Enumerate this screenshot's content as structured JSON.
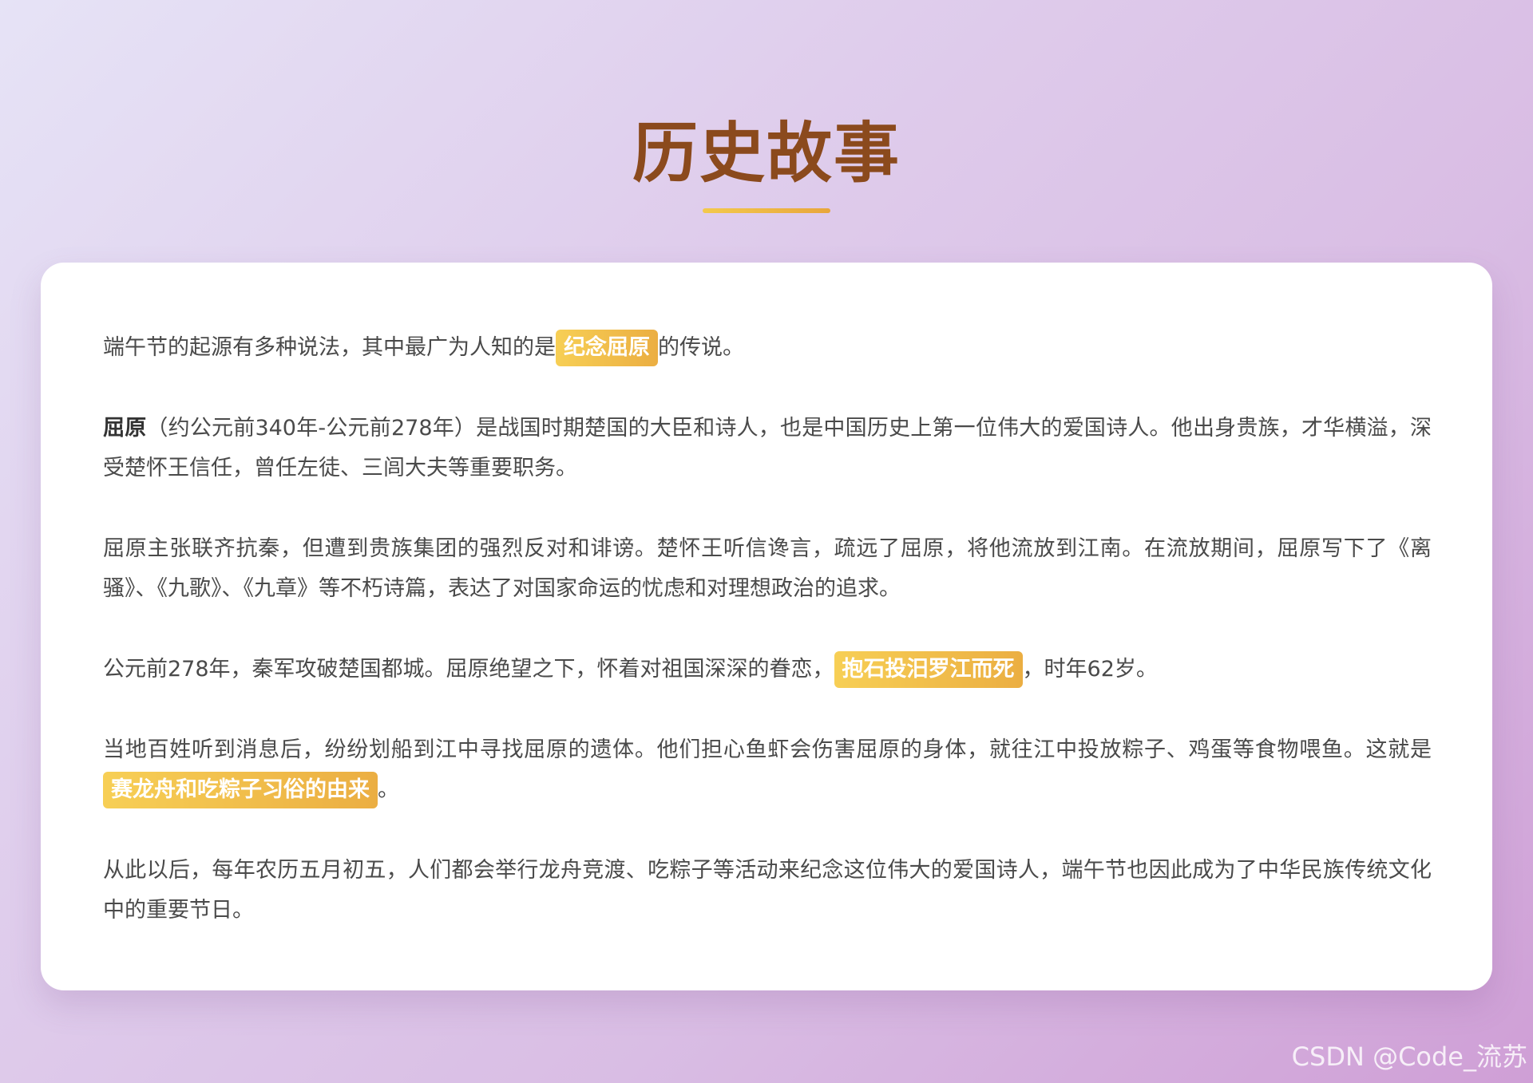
{
  "page": {
    "title": "历史故事",
    "watermark": "CSDN @Code_流苏"
  },
  "paragraphs": {
    "p1": {
      "before": "端午节的起源有多种说法，其中最广为人知的是",
      "highlight": "纪念屈原",
      "after": "的传说。"
    },
    "p2": {
      "bold": "屈原",
      "rest": "（约公元前340年-公元前278年）是战国时期楚国的大臣和诗人，也是中国历史上第一位伟大的爱国诗人。他出身贵族，才华横溢，深受楚怀王信任，曾任左徒、三闾大夫等重要职务。"
    },
    "p3": {
      "text": "屈原主张联齐抗秦，但遭到贵族集团的强烈反对和诽谤。楚怀王听信谗言，疏远了屈原，将他流放到江南。在流放期间，屈原写下了《离骚》、《九歌》、《九章》等不朽诗篇，表达了对国家命运的忧虑和对理想政治的追求。"
    },
    "p4": {
      "before": "公元前278年，秦军攻破楚国都城。屈原绝望之下，怀着对祖国深深的眷恋，",
      "highlight": "抱石投汨罗江而死",
      "after": "，时年62岁。"
    },
    "p5": {
      "before": "当地百姓听到消息后，纷纷划船到江中寻找屈原的遗体。他们担心鱼虾会伤害屈原的身体，就往江中投放粽子、鸡蛋等食物喂鱼。这就是",
      "highlight": "赛龙舟和吃粽子习俗的由来",
      "after": "。"
    },
    "p6": {
      "text": "从此以后，每年农历五月初五，人们都会举行龙舟竞渡、吃粽子等活动来纪念这位伟大的爱国诗人，端午节也因此成为了中华民族传统文化中的重要节日。"
    }
  },
  "colors": {
    "title": "#8b4a1d",
    "highlight_start": "#f7cf55",
    "highlight_end": "#ebae42",
    "body_text": "#4a4a4a"
  }
}
